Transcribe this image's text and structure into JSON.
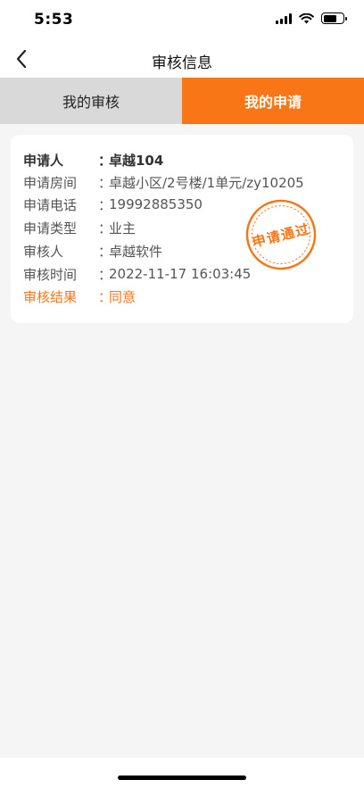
{
  "status": {
    "time": "5:53"
  },
  "nav": {
    "title": "审核信息"
  },
  "tabs": [
    {
      "label": "我的审核",
      "active": false
    },
    {
      "label": "我的申请",
      "active": true
    }
  ],
  "record": {
    "applicant_label": "申请人",
    "applicant": "卓越104",
    "room_label": "申请房间",
    "room": "卓越小区/2号楼/1单元/zy10205",
    "phone_label": "申请电话",
    "phone": "19992885350",
    "type_label": "申请类型",
    "type": "业主",
    "reviewer_label": "审核人",
    "reviewer": "卓越软件",
    "time_label": "审核时间",
    "time": "2022-11-17 16:03:45",
    "result_label": "审核结果",
    "result": "同意",
    "colon": "："
  },
  "stamp": {
    "text": "申请通过"
  },
  "colors": {
    "accent": "#f97617",
    "tab_inactive": "#d9d9d9",
    "background": "#f5f5f5"
  }
}
